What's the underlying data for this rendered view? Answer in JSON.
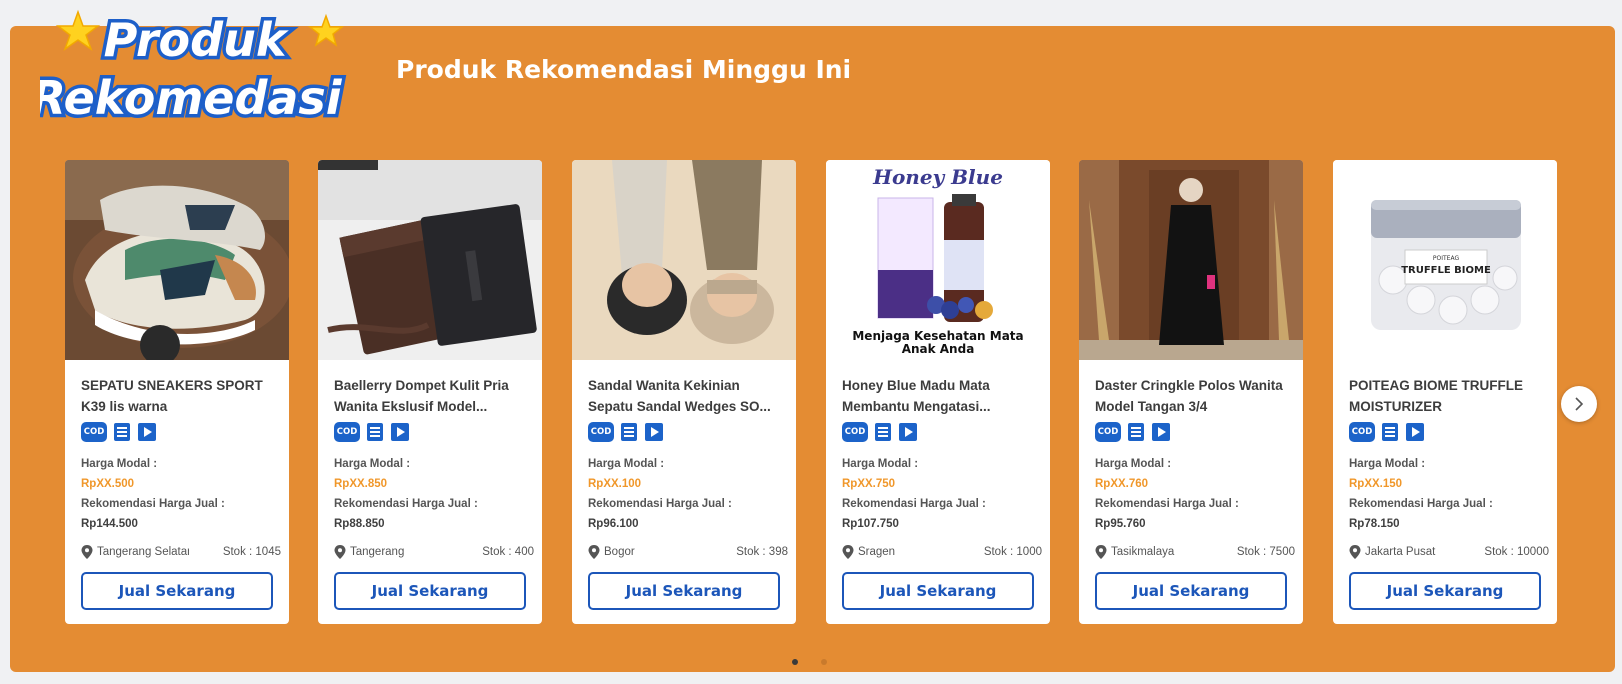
{
  "section": {
    "logo_line1": "Produk",
    "logo_line2": "Rekomedasi",
    "title": "Produk Rekomendasi Minggu Ini"
  },
  "labels": {
    "harga_modal": "Harga Modal :",
    "rekomendasi_harga": "Rekomendasi Harga Jual :",
    "button": "Jual Sekarang",
    "cod": "COD"
  },
  "products": [
    {
      "name_line1": "SEPATU SNEAKERS SPORT",
      "name_line2": "K39 lis warna",
      "harga_modal": "RpXX.500",
      "harga_jual": "Rp144.500",
      "location": "Tangerang Selatan",
      "stok": "Stok : 1045"
    },
    {
      "name_line1": "Baellerry Dompet Kulit Pria",
      "name_line2": "Wanita Ekslusif Model...",
      "harga_modal": "RpXX.850",
      "harga_jual": "Rp88.850",
      "location": "Tangerang",
      "stok": "Stok : 400"
    },
    {
      "name_line1": "Sandal Wanita Kekinian",
      "name_line2": "Sepatu Sandal Wedges SO...",
      "harga_modal": "RpXX.100",
      "harga_jual": "Rp96.100",
      "location": "Bogor",
      "stok": "Stok : 398"
    },
    {
      "name_line1": "Honey Blue Madu Mata",
      "name_line2": "Membantu Mengatasi...",
      "harga_modal": "RpXX.750",
      "harga_jual": "Rp107.750",
      "location": "Sragen",
      "stok": "Stok : 1000",
      "image_text_brand": "Honey Blue",
      "image_caption_1": "Menjaga Kesehatan Mata",
      "image_caption_2": "Anak Anda"
    },
    {
      "name_line1": "Daster Cringkle Polos Wanita",
      "name_line2": "Model Tangan 3/4",
      "harga_modal": "RpXX.760",
      "harga_jual": "Rp95.760",
      "location": "Tasikmalaya",
      "stok": "Stok : 7500"
    },
    {
      "name_line1": "POITEAG BIOME TRUFFLE",
      "name_line2": "MOISTURIZER",
      "harga_modal": "RpXX.150",
      "harga_jual": "Rp78.150",
      "location": "Jakarta Pusat",
      "stok": "Stok : 10000",
      "image_text_brand": "POITEAG",
      "image_text_product": "TRUFFLE BIOME"
    }
  ],
  "colors": {
    "banner": "#e48c33",
    "primary_blue": "#1c56b9",
    "price_orange": "#f0972a"
  },
  "icons": [
    "star-icon",
    "cod-badge-icon",
    "document-icon",
    "video-icon",
    "location-pin-icon",
    "chevron-right-icon"
  ],
  "carousel": {
    "page": 1,
    "total_pages": 2
  }
}
